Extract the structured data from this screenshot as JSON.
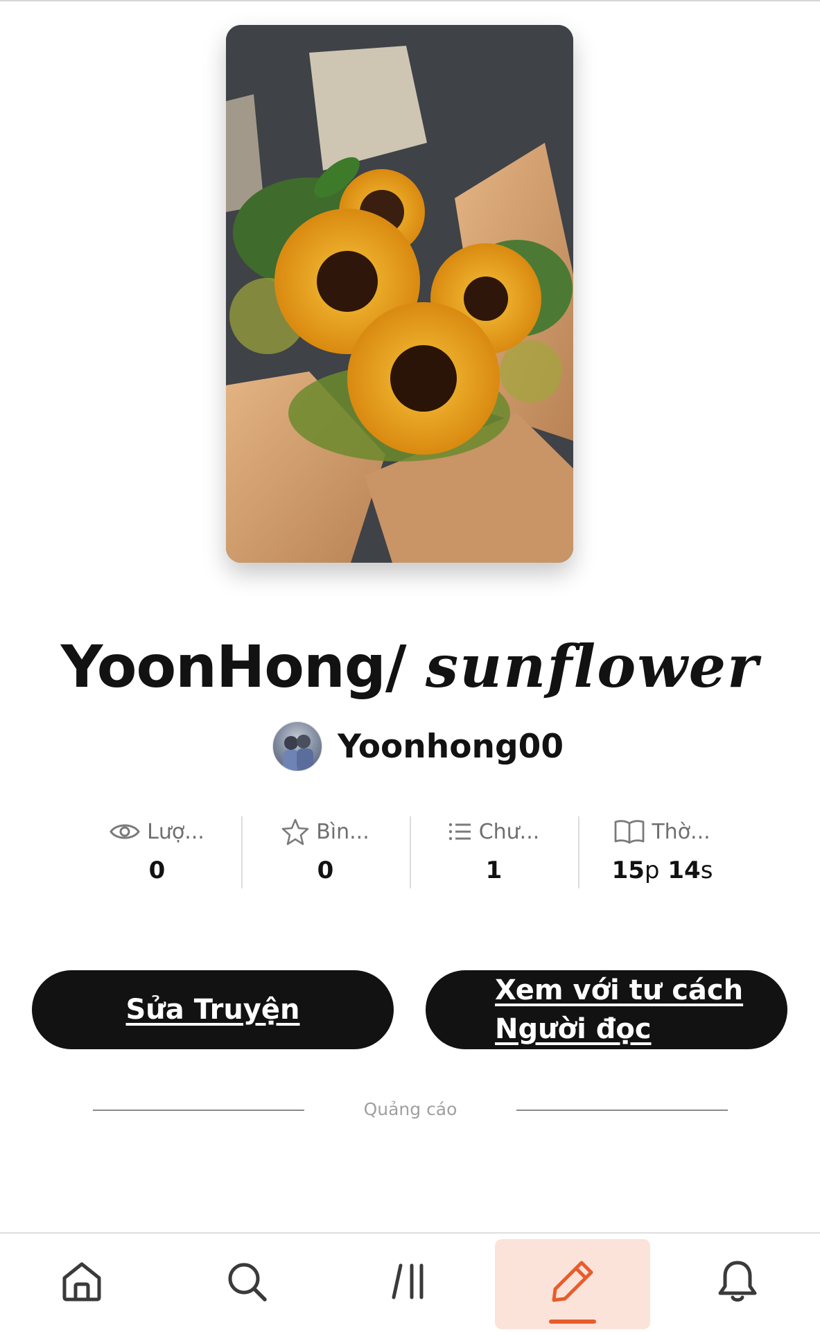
{
  "story": {
    "title_part1": "YoonHong/",
    "title_part2": "sunflower",
    "author": "Yoonhong00"
  },
  "stats": [
    {
      "icon": "eye-icon",
      "label": "Lượ...",
      "value": "0"
    },
    {
      "icon": "star-icon",
      "label": "Bìn...",
      "value": "0"
    },
    {
      "icon": "list-icon",
      "label": "Chư...",
      "value": "1"
    },
    {
      "icon": "book-icon",
      "label": "Thờ...",
      "value_num1": "15",
      "value_unit1": "p",
      "value_num2": "14",
      "value_unit2": "s"
    }
  ],
  "buttons": {
    "edit": "Sửa Truyện",
    "view_line1": "Xem với tư cách",
    "view_line2": "Người đọc"
  },
  "ad": {
    "label": "Quảng cáo"
  },
  "nav": {
    "items": [
      "home-icon",
      "search-icon",
      "library-icon",
      "write-icon",
      "bell-icon"
    ],
    "active": "write-icon",
    "accent": "#e85c2c",
    "active_bg": "#fbe3d9"
  }
}
